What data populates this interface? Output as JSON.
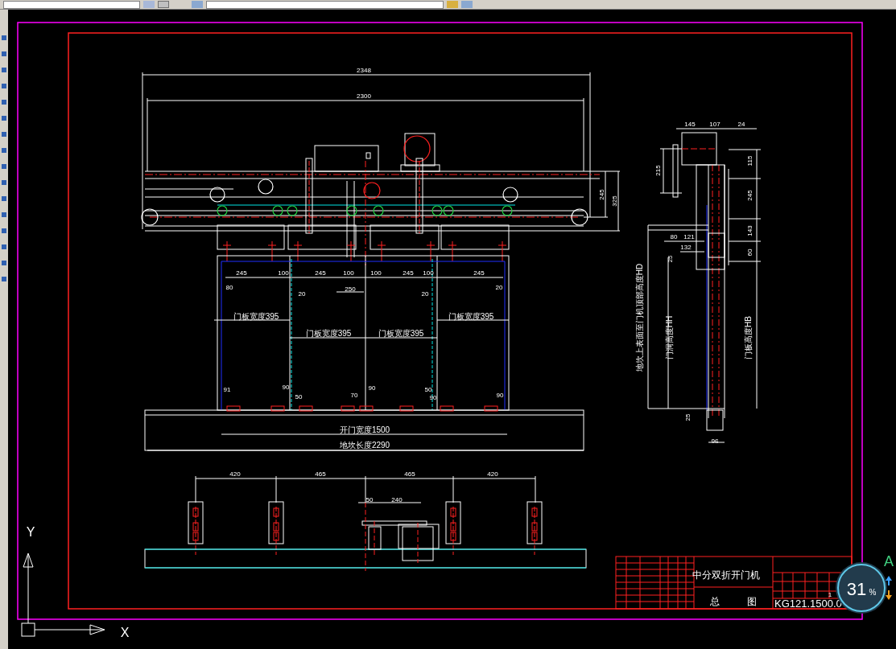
{
  "front_view": {
    "overall_dims": [
      "2348",
      "2300"
    ],
    "height_dims": [
      "245",
      "325"
    ],
    "spacing_dims": [
      "245",
      "100",
      "245",
      "100",
      "100",
      "245",
      "100",
      "245"
    ],
    "offset_dims": [
      "80",
      "20",
      "250",
      "20",
      "20"
    ],
    "panel_widths": [
      "门板宽度395",
      "门板宽度395",
      "门板宽度395",
      "门板宽度395"
    ],
    "bottom_dims": [
      "91",
      "90",
      "50",
      "70",
      "90",
      "50",
      "90",
      "90"
    ],
    "opening_width": "开门宽度1500",
    "sill_length": "地坎长度2290"
  },
  "side_view": {
    "top_dims": [
      "145",
      "107",
      "24"
    ],
    "vertical_dims": [
      "215",
      "115",
      "245",
      "143",
      "60"
    ],
    "bracket_dims": [
      "80",
      "121",
      "132",
      "25"
    ],
    "bottom_dims": [
      "25",
      "96"
    ],
    "height_labels": [
      "地坎上表面至门机顶部高度HD",
      "门洞高度HH",
      "门板高度HB"
    ]
  },
  "plan_view": {
    "spacing_dims": [
      "420",
      "465",
      "465",
      "420"
    ],
    "motor_dims": [
      "50",
      "240"
    ]
  },
  "title_block": {
    "title": "中分双折开门机",
    "drawing_type": [
      "总",
      "图"
    ],
    "drawing_number": "KG121.1500.0",
    "scale": "1"
  },
  "axes": {
    "y": "Y",
    "x": "X"
  },
  "progress_widget": {
    "percent": "31",
    "unit": "%",
    "badge": "A"
  }
}
